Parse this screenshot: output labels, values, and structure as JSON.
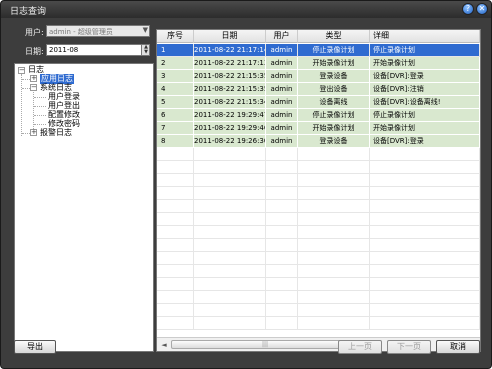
{
  "window": {
    "title": "日志查询",
    "help_glyph": "?",
    "close_glyph": "✕"
  },
  "filters": {
    "user_label": "用户:",
    "user_value": "admin - 超级管理员",
    "date_label": "日期:",
    "date_value": "2011-08"
  },
  "tree": {
    "root": "日志",
    "items": [
      {
        "label": "应用日志",
        "selected": true
      },
      {
        "label": "系统日志",
        "selected": false
      },
      {
        "label": "用户登录",
        "selected": false
      },
      {
        "label": "用户登出",
        "selected": false
      },
      {
        "label": "配置修改",
        "selected": false
      },
      {
        "label": "修改密码",
        "selected": false
      },
      {
        "label": "报警日志",
        "selected": false
      }
    ]
  },
  "table": {
    "columns": [
      "序号",
      "日期",
      "用户",
      "类型",
      "详细"
    ],
    "rows": [
      [
        "1",
        "2011-08-22 21:17:14",
        "admin",
        "停止录像计划",
        "停止录像计划"
      ],
      [
        "2",
        "2011-08-22 21:17:13",
        "admin",
        "开始录像计划",
        "开始录像计划"
      ],
      [
        "3",
        "2011-08-22 21:15:35",
        "admin",
        "登录设备",
        "设备[DVR]:登录"
      ],
      [
        "4",
        "2011-08-22 21:15:35",
        "admin",
        "登出设备",
        "设备[DVR]:注销"
      ],
      [
        "5",
        "2011-08-22 21:15:34",
        "admin",
        "设备离线",
        "设备[DVR]:设备离线!"
      ],
      [
        "6",
        "2011-08-22 19:29:47",
        "admin",
        "停止录像计划",
        "停止录像计划"
      ],
      [
        "7",
        "2011-08-22 19:29:46",
        "admin",
        "开始录像计划",
        "开始录像计划"
      ],
      [
        "8",
        "2011-08-22 19:26:30",
        "admin",
        "登录设备",
        "设备[DVR]:登录"
      ]
    ],
    "selected_row": 0,
    "empty_rows": 14
  },
  "buttons": {
    "export": "导出",
    "prev": "上一页",
    "next": "下一页",
    "cancel": "取消"
  },
  "colors": {
    "selection": "#2f6bd0",
    "row_fill": "#d9e8cf",
    "window_bg": "#3d3d3d"
  }
}
